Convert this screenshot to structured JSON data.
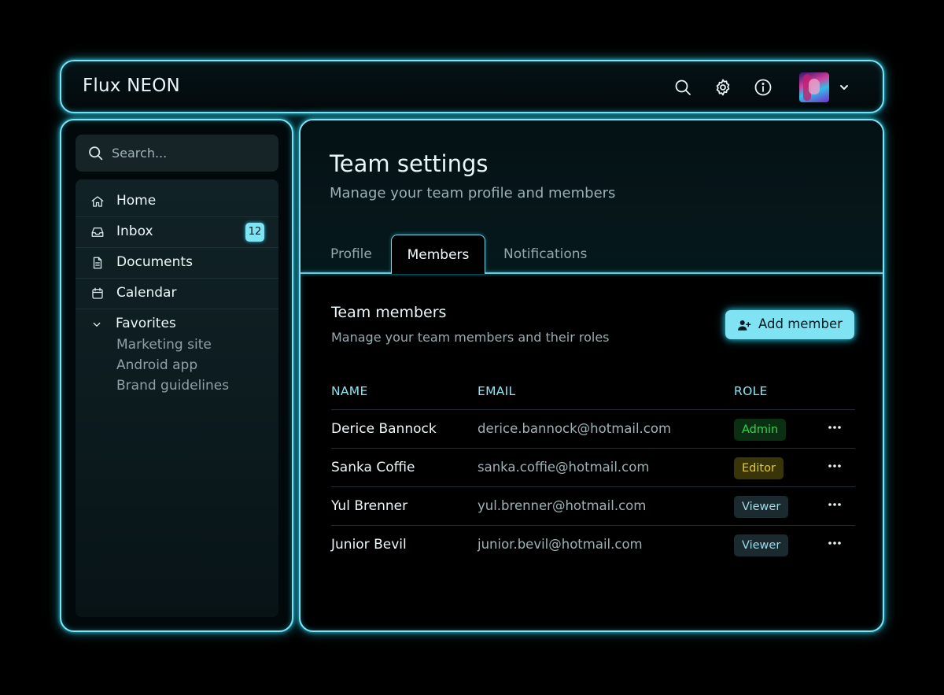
{
  "header": {
    "title": "Flux NEON",
    "icons": [
      "search-icon",
      "gear-icon",
      "info-icon"
    ],
    "avatar": "avatar"
  },
  "sidebar": {
    "search": {
      "placeholder": "Search..."
    },
    "items": [
      {
        "label": "Home",
        "icon": "home-icon"
      },
      {
        "label": "Inbox",
        "icon": "inbox-icon",
        "badge": "12"
      },
      {
        "label": "Documents",
        "icon": "document-icon"
      },
      {
        "label": "Calendar",
        "icon": "calendar-icon"
      },
      {
        "label": "Favorites",
        "icon": "chevron-down-icon"
      }
    ],
    "favorites": [
      "Marketing site",
      "Android app",
      "Brand guidelines"
    ]
  },
  "main": {
    "title": "Team settings",
    "subtitle": "Manage your team profile and members",
    "tabs": [
      {
        "label": "Profile",
        "active": false
      },
      {
        "label": "Members",
        "active": true
      },
      {
        "label": "Notifications",
        "active": false
      }
    ],
    "section": {
      "title": "Team members",
      "subtitle": "Manage your team members and their roles",
      "add_label": "Add member"
    },
    "table": {
      "headers": [
        "NAME",
        "EMAIL",
        "ROLE"
      ],
      "rows": [
        {
          "name": "Derice Bannock",
          "email": "derice.bannock@hotmail.com",
          "role": "Admin"
        },
        {
          "name": "Sanka Coffie",
          "email": "sanka.coffie@hotmail.com",
          "role": "Editor"
        },
        {
          "name": "Yul Brenner",
          "email": "yul.brenner@hotmail.com",
          "role": "Viewer"
        },
        {
          "name": "Junior Bevil",
          "email": "junior.bevil@hotmail.com",
          "role": "Viewer"
        }
      ]
    }
  },
  "colors": {
    "accent": "#7fe3f3",
    "admin": "#39d34f",
    "editor": "#e3cb2c",
    "viewer": "#9fd8e6"
  }
}
